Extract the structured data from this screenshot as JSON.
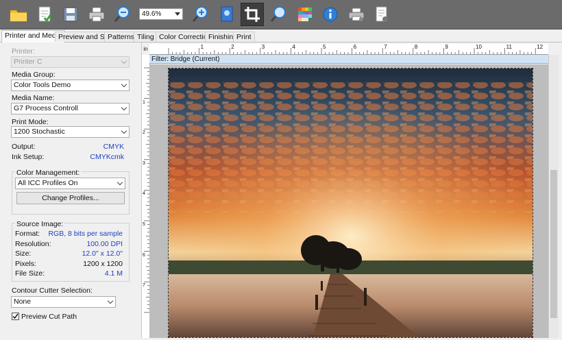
{
  "toolbar": {
    "zoom_value": "49.6%",
    "buttons": [
      {
        "icon": "open-folder-icon"
      },
      {
        "icon": "document-check-icon"
      },
      {
        "icon": "save-icon"
      },
      {
        "icon": "print-icon"
      },
      {
        "icon": "zoom-out-icon"
      },
      {
        "icon": "zoom-in-icon"
      },
      {
        "icon": "fit-page-icon"
      },
      {
        "icon": "crop-icon"
      },
      {
        "icon": "zoom-magnifier-icon"
      },
      {
        "icon": "color-grid-icon"
      },
      {
        "icon": "info-icon"
      },
      {
        "icon": "printer-settings-icon"
      },
      {
        "icon": "job-properties-icon"
      }
    ]
  },
  "tabs": [
    "Printer and Media",
    "Preview and Size",
    "Patterns",
    "Tiling",
    "Color Correction",
    "Finishing",
    "Print"
  ],
  "panel": {
    "printer_label": "Printer:",
    "printer_value": "Printer C",
    "media_group_label": "Media Group:",
    "media_group_value": "Color Tools Demo",
    "media_name_label": "Media Name:",
    "media_name_value": "G7 Process Controll",
    "print_mode_label": "Print Mode:",
    "print_mode_value": "1200 Stochastic",
    "output_label": "Output:",
    "output_value": "CMYK",
    "ink_setup_label": "Ink Setup:",
    "ink_setup_value": "CMYKcmk",
    "color_management_label": "Color Management:",
    "color_management_value": "All ICC Profiles On",
    "change_profiles_label": "Change Profiles...",
    "source_image_label": "Source Image:",
    "source": [
      {
        "label": "Format:",
        "value": "RGB, 8 bits per sample"
      },
      {
        "label": "Resolution:",
        "value": "100.00 DPI"
      },
      {
        "label": "Size:",
        "value": "12.0\" x 12.0\""
      },
      {
        "label": "Pixels:",
        "value": "1200 x 1200"
      },
      {
        "label": "File Size:",
        "value": "4.1 M"
      }
    ],
    "contour_label": "Contour Cutter Selection:",
    "contour_value": "None",
    "preview_cut_label": "Preview Cut Path",
    "preview_cut_checked": true
  },
  "ruler": {
    "unit": "in",
    "marks": [
      "1",
      "2",
      "3",
      "4",
      "5",
      "6",
      "7",
      "8",
      "9",
      "10",
      "11",
      "12"
    ],
    "left_marks": [
      "1",
      "2",
      "3",
      "4",
      "5",
      "6",
      "7"
    ]
  },
  "filter_label": "Filter: Bridge (Current)",
  "colors": {
    "toolbar": "#6b6b6b",
    "value_blue": "#2040c0",
    "filter_bar": "#cfe3f5"
  }
}
